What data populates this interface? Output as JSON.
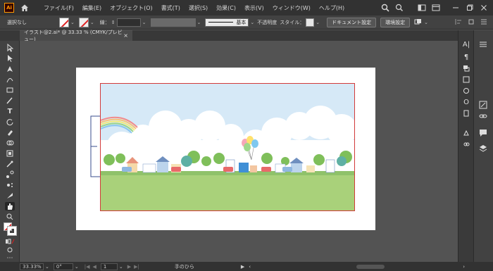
{
  "app": {
    "logo": "Ai"
  },
  "menu": [
    "ファイル(F)",
    "編集(E)",
    "オブジェクト(O)",
    "書式(T)",
    "選択(S)",
    "効果(C)",
    "表示(V)",
    "ウィンドウ(W)",
    "ヘルプ(H)"
  ],
  "control": {
    "selection": "選択なし",
    "stroke_label": "線：",
    "stroke_value": "",
    "brush_label": "基本",
    "opacity_label": "不透明度",
    "style_label": "スタイル：",
    "doc_settings": "ドキュメント設定",
    "prefs": "環境設定"
  },
  "tab": {
    "title": "イラスト@2.ai* @ 33.33 % (CMYK/プレビュー)",
    "close": "×"
  },
  "status": {
    "zoom": "33.33%",
    "rotation": "0°",
    "artboard": "1",
    "tool": "手のひら"
  },
  "colors": {
    "artboard_border": "#d23a3a",
    "sky": "#cfe6f7",
    "grass": "#a9d17a"
  }
}
